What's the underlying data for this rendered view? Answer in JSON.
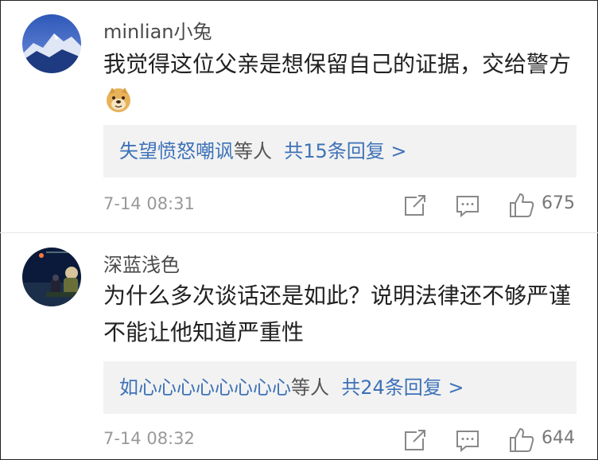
{
  "comments": [
    {
      "username": "minlian小兔",
      "text": "我觉得这位父亲是想保留自己的证据，交给警方",
      "emoji": "doge-emoji",
      "replies_prefix": "失望愤怒嘲讽",
      "replies_mid": "等人",
      "replies_count": "共15条回复 >",
      "time": "7-14 08:31",
      "likes": "675"
    },
    {
      "username": "深蓝浅色",
      "text": "为什么多次谈话还是如此？说明法律还不够严谨不能让他知道严重性",
      "replies_prefix": "如心心心心心心心心",
      "replies_mid": "等人",
      "replies_count": "共24条回复 >",
      "time": "7-14 08:32",
      "likes": "644"
    }
  ],
  "icons": [
    "share-icon",
    "reply-icon",
    "like-icon"
  ],
  "colors": {
    "link": "#3d72b8",
    "reply_bg": "#f2f2f2",
    "meta": "#999999"
  }
}
